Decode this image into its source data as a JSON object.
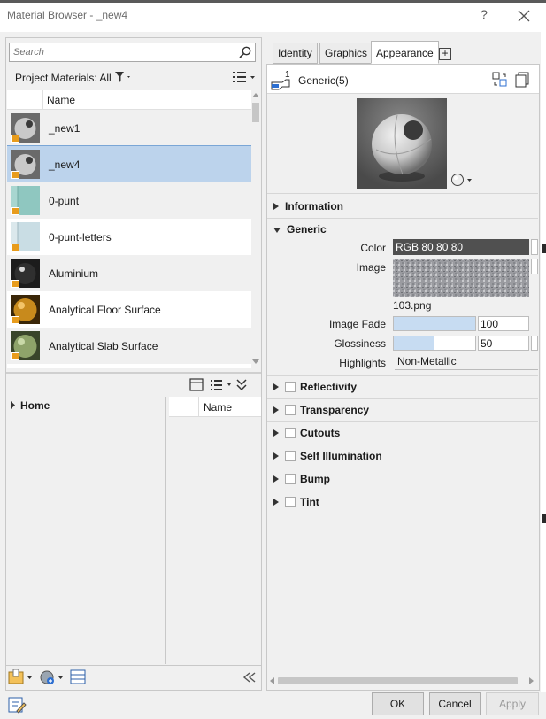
{
  "window": {
    "title": "Material Browser - _new4",
    "help_label": "?"
  },
  "search": {
    "placeholder": "Search"
  },
  "filter": {
    "label": "Project Materials: All"
  },
  "list": {
    "header": "Name",
    "selected_index": 1,
    "items": [
      {
        "label": "_new1",
        "swatch": "sphere"
      },
      {
        "label": "_new4",
        "swatch": "sphere"
      },
      {
        "label": "0-punt",
        "swatch": "glass-teal"
      },
      {
        "label": "0-punt-letters",
        "swatch": "glass-light"
      },
      {
        "label": "Aluminium",
        "swatch": "metal-dark"
      },
      {
        "label": "Analytical Floor Surface",
        "swatch": "amber"
      },
      {
        "label": "Analytical Slab Surface",
        "swatch": "olive"
      }
    ]
  },
  "library": {
    "tree_root": "Home",
    "grid_header": "Name"
  },
  "tabs": [
    {
      "label": "Identity",
      "active": false
    },
    {
      "label": "Graphics",
      "active": false
    },
    {
      "label": "Appearance",
      "active": true
    }
  ],
  "tab_add_label": "+",
  "asset": {
    "count": "1",
    "name": "Generic(5)"
  },
  "sections": {
    "information": "Information",
    "generic": "Generic",
    "reflectivity": "Reflectivity",
    "transparency": "Transparency",
    "cutouts": "Cutouts",
    "self_illumination": "Self Illumination",
    "bump": "Bump",
    "tint": "Tint"
  },
  "generic": {
    "color_label": "Color",
    "color_value": "RGB 80 80 80",
    "image_label": "Image",
    "image_file": "103.png",
    "image_fade_label": "Image Fade",
    "image_fade_value": "100",
    "image_fade_fraction": 1.0,
    "glossiness_label": "Glossiness",
    "glossiness_value": "50",
    "glossiness_fraction": 0.5,
    "highlights_label": "Highlights",
    "highlights_value": "Non-Metallic"
  },
  "buttons": {
    "ok": "OK",
    "cancel": "Cancel",
    "apply": "Apply"
  },
  "colors": {
    "selected_row": "#bcd3ec",
    "badge": "#e89c1c",
    "color_swatch": "#505050",
    "slider_fill": "#c7dcf2"
  }
}
